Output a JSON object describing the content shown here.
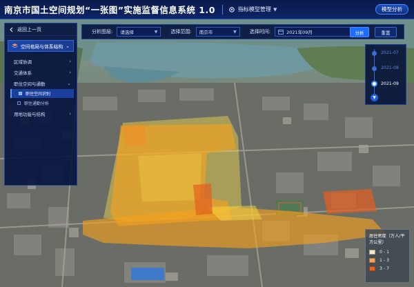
{
  "header": {
    "app_title": "南京市国土空间规划“一张图”实施监督信息系统 1.0",
    "module_menu_label": "指标模型管理",
    "model_analysis_button": "模型分析"
  },
  "toolbar": {
    "layer_label": "分析图层:",
    "layer_value": "请选择",
    "scope_label": "选择范围:",
    "scope_value": "南京市",
    "time_label": "选择时间:",
    "time_value": "2021年09月",
    "analyze_button": "分析",
    "reset_button": "重置"
  },
  "sidebar": {
    "back_label": "返回上一页",
    "section_title": "空间格局与体系结构",
    "items": [
      {
        "label": "区域协调"
      },
      {
        "label": "交通体系"
      },
      {
        "label": "职住空间与通勤"
      },
      {
        "label": "用地功能与结构"
      }
    ],
    "subitems": [
      {
        "label": "职住空间识别",
        "active": true
      },
      {
        "label": "职住通勤分析",
        "active": false
      }
    ]
  },
  "timeline": {
    "dates": [
      "2021-07",
      "2021-08",
      "2021-09"
    ],
    "active_index": 2
  },
  "legend": {
    "title": "居住密度（万人/平方公里）",
    "entries": [
      {
        "label": "0 - 1",
        "color": "#f6e7c8"
      },
      {
        "label": "1 - 3",
        "color": "#f2a55a"
      },
      {
        "label": "3 - 7",
        "color": "#e2622a"
      }
    ]
  },
  "colors": {
    "header_bg": "#0d2466",
    "accent": "#1d6cff",
    "overlay_low": "#f6d94a",
    "overlay_mid": "#f7a21c",
    "overlay_high": "#e25e20"
  }
}
